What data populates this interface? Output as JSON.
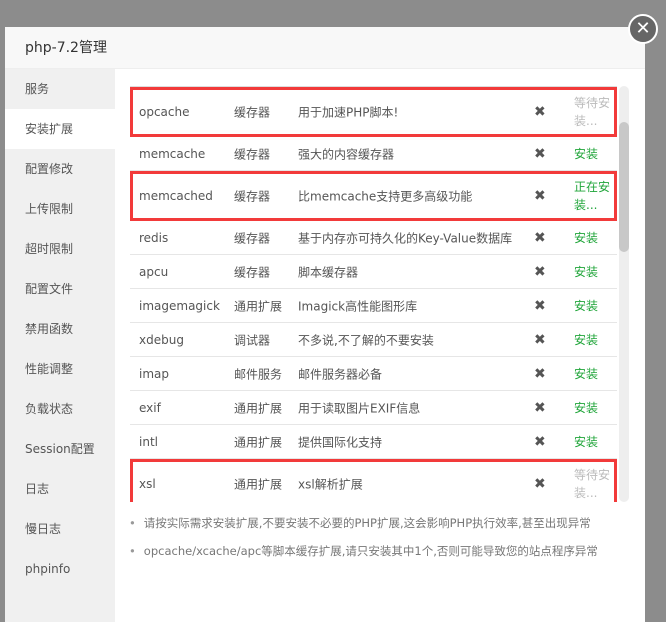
{
  "dialog": {
    "title": "php-7.2管理",
    "close_icon": "close-icon"
  },
  "sidebar": [
    "服务",
    "安装扩展",
    "配置修改",
    "上传限制",
    "超时限制",
    "配置文件",
    "禁用函数",
    "性能调整",
    "负载状态",
    "Session配置",
    "日志",
    "慢日志",
    "phpinfo"
  ],
  "active_index": 1,
  "extensions": [
    {
      "name": "opcache",
      "type": "缓存器",
      "desc": "用于加速PHP脚本!",
      "status": "等待安装...",
      "state": "waiting",
      "highlight": true
    },
    {
      "name": "memcache",
      "type": "缓存器",
      "desc": "强大的内容缓存器",
      "status": "安装",
      "state": "install",
      "highlight": false
    },
    {
      "name": "memcached",
      "type": "缓存器",
      "desc": "比memcache支持更多高级功能",
      "status": "正在安装...",
      "state": "installing",
      "highlight": true
    },
    {
      "name": "redis",
      "type": "缓存器",
      "desc": "基于内存亦可持久化的Key-Value数据库",
      "status": "安装",
      "state": "install",
      "highlight": false
    },
    {
      "name": "apcu",
      "type": "缓存器",
      "desc": "脚本缓存器",
      "status": "安装",
      "state": "install",
      "highlight": false
    },
    {
      "name": "imagemagick",
      "type": "通用扩展",
      "desc": "Imagick高性能图形库",
      "status": "安装",
      "state": "install",
      "highlight": false
    },
    {
      "name": "xdebug",
      "type": "调试器",
      "desc": "不多说,不了解的不要安装",
      "status": "安装",
      "state": "install",
      "highlight": false
    },
    {
      "name": "imap",
      "type": "邮件服务",
      "desc": "邮件服务器必备",
      "status": "安装",
      "state": "install",
      "highlight": false
    },
    {
      "name": "exif",
      "type": "通用扩展",
      "desc": "用于读取图片EXIF信息",
      "status": "安装",
      "state": "install",
      "highlight": false
    },
    {
      "name": "intl",
      "type": "通用扩展",
      "desc": "提供国际化支持",
      "status": "安装",
      "state": "install",
      "highlight": false
    },
    {
      "name": "xsl",
      "type": "通用扩展",
      "desc": "xsl解析扩展",
      "status": "等待安装...",
      "state": "waiting",
      "highlight": true
    }
  ],
  "delete_symbol": "✖",
  "tips": [
    "请按实际需求安装扩展,不要安装不必要的PHP扩展,这会影响PHP执行效率,甚至出现异常",
    "opcache/xcache/apc等脚本缓存扩展,请只安装其中1个,否则可能导致您的站点程序异常"
  ]
}
